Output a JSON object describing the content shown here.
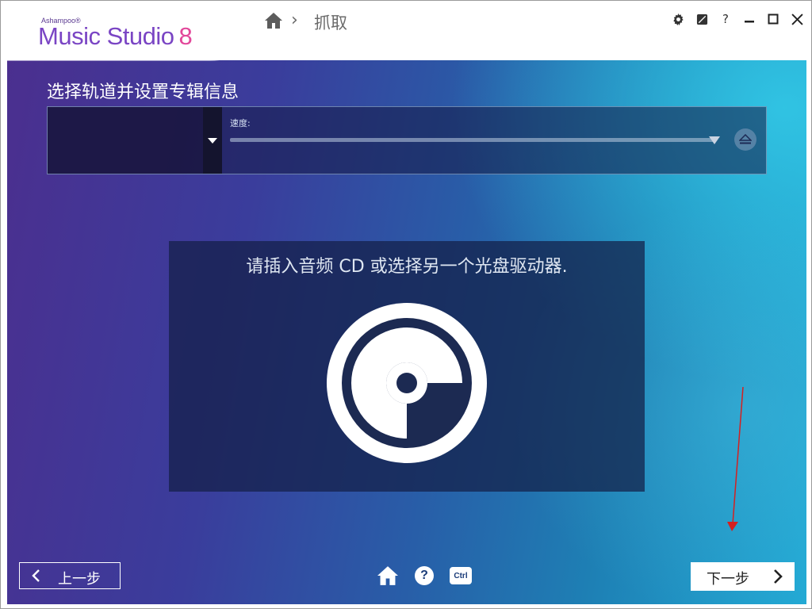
{
  "app": {
    "brand_small": "Ashampoo®",
    "brand_name": "Music Studio",
    "brand_version": "8"
  },
  "breadcrumb": {
    "separator": "›",
    "current": "抓取"
  },
  "titlebar_icons": [
    "gear-icon",
    "skin-icon",
    "help-icon",
    "minimize-icon",
    "maximize-icon",
    "close-icon"
  ],
  "titlebar_help": "?",
  "page": {
    "title": "选择轨道并设置专辑信息"
  },
  "drive": {
    "selected": "",
    "speed_label": "速度:"
  },
  "cd_panel": {
    "message": "请插入音频 CD 或选择另一个光盘驱动器."
  },
  "footer": {
    "back_label": "上一步",
    "next_label": "下一步",
    "help_glyph": "?",
    "ctrl_label": "Ctrl"
  },
  "colors": {
    "brand_purple": "#7a45c4",
    "brand_pink": "#e2479a",
    "arrow_red": "#d42020"
  }
}
